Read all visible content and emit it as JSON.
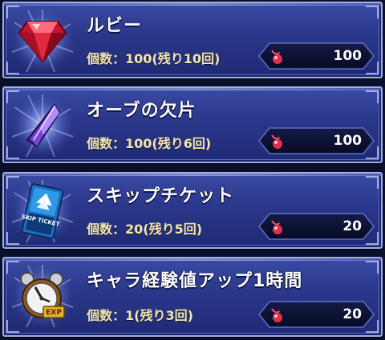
{
  "items": [
    {
      "name": "ルビー",
      "count": "個数：100(残り10回)",
      "price": "100",
      "icon": "ruby-gem-icon"
    },
    {
      "name": "オーブの欠片",
      "count": "個数：100(残り6回)",
      "price": "100",
      "icon": "orb-shard-icon"
    },
    {
      "name": "スキップチケット",
      "count": "個数：20(残り5回)",
      "price": "20",
      "icon": "skip-ticket-icon",
      "icon_text": "SKIP TICKET"
    },
    {
      "name": "キャラ経験値アップ1時間",
      "count": "個数：1(残り3回)",
      "price": "20",
      "icon": "exp-clock-icon",
      "icon_text": "EXP"
    }
  ],
  "currency_icon": "red-flame-orb-icon",
  "colors": {
    "panel": "#2a378a",
    "count_text": "#f5e7a8",
    "price_box": "#0d1236",
    "currency": "#e0304a"
  }
}
